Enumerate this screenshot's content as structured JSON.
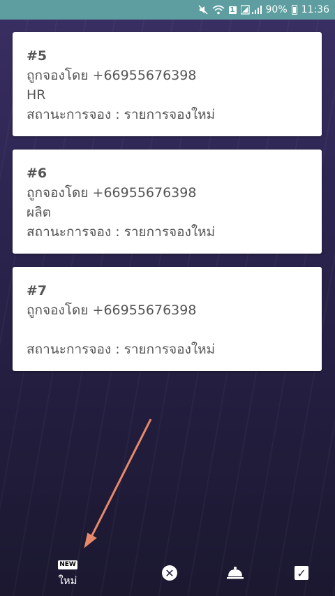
{
  "status_bar": {
    "icons": [
      "mute-icon",
      "wifi-icon",
      "sim-icon",
      "signal-icon",
      "battery-icon"
    ],
    "sim_label": "1",
    "battery": "90%",
    "time": "11:36"
  },
  "bookings": [
    {
      "id": "#5",
      "booked_by": "ถูกจองโดย +66955676398",
      "department": "HR",
      "status": "สถานะการจอง : รายการจองใหม่"
    },
    {
      "id": "#6",
      "booked_by": "ถูกจองโดย +66955676398",
      "department": "ผลิต",
      "status": "สถานะการจอง : รายการจองใหม่"
    },
    {
      "id": "#7",
      "booked_by": "ถูกจองโดย +66955676398",
      "department": "",
      "status": "สถานะการจอง : รายการจองใหม่"
    }
  ],
  "bottom_nav": {
    "new_badge": "NEW",
    "new_label": "ใหม่",
    "cancel_glyph": "✕",
    "check_glyph": "✓"
  },
  "colors": {
    "status_bar": "#5f9ea0",
    "background_top": "#3a2f63",
    "background_bottom": "#1b1830",
    "card": "#ffffff",
    "arrow": "#e8896a"
  }
}
